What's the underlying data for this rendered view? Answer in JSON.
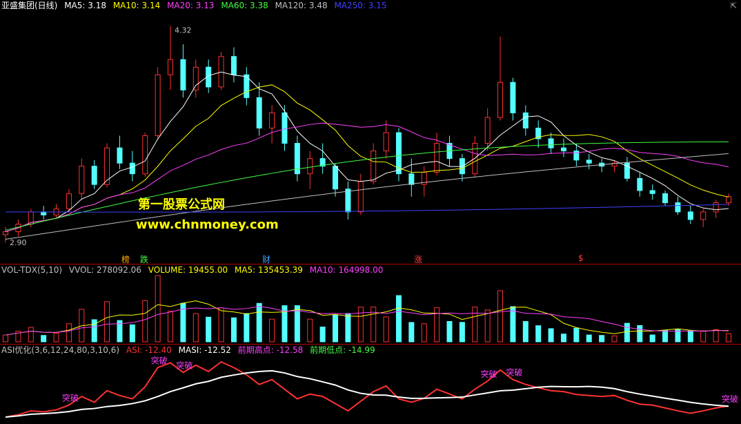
{
  "main": {
    "title": "亚盛集团(日线)",
    "ma": [
      {
        "label": "MA5: 3.18",
        "color": "#ffffff"
      },
      {
        "label": "MA10: 3.14",
        "color": "#ffff00"
      },
      {
        "label": "MA20: 3.13",
        "color": "#ff40ff"
      },
      {
        "label": "MA60: 3.38",
        "color": "#40ff40"
      },
      {
        "label": "MA120: 3.48",
        "color": "#c0c0c0"
      },
      {
        "label": "MA250: 3.15",
        "color": "#4040ff"
      }
    ],
    "high_label": "4.32",
    "low_label": "2.90",
    "events": [
      {
        "label": "榜",
        "color": "#ffb000"
      },
      {
        "label": "跌",
        "color": "#40ff40"
      },
      {
        "label": "财",
        "color": "#40a0ff"
      },
      {
        "label": "涨",
        "color": "#ff4040"
      },
      {
        "label": "$",
        "color": "#ff4040"
      }
    ],
    "watermark_cn": "第一股票公式网",
    "watermark_url": "www.chnmoney.com",
    "colors": {
      "up": "#ff3232",
      "down": "#54ffff",
      "frame": "#b00000"
    }
  },
  "vol": {
    "name": "VOL-TDX(5,10)",
    "items": [
      {
        "label": "VVOL: 278092.06",
        "color": "#c0c0c0"
      },
      {
        "label": "VOLUME: 19455.00",
        "color": "#ffff00"
      },
      {
        "label": "MA5: 135453.39",
        "color": "#ffff00"
      },
      {
        "label": "MA10: 164998.00",
        "color": "#ff40ff"
      }
    ]
  },
  "asi": {
    "name": "ASI优化(3,6,12,24,80,3,10,6)",
    "items": [
      {
        "label": "ASI: -12.40",
        "color": "#ff3232"
      },
      {
        "label": "MASI: -12.52",
        "color": "#ffffff"
      },
      {
        "label": "前期高点: -12.58",
        "color": "#ff40ff"
      },
      {
        "label": "前期低点: -14.99",
        "color": "#40ff40"
      }
    ],
    "breakout_label": "突破"
  },
  "chart_data": {
    "type": "candlestick",
    "high_price": 4.32,
    "low_price": 2.9,
    "ohlc_approx": [
      [
        2.95,
        3.0,
        2.9,
        2.97
      ],
      [
        2.97,
        3.05,
        2.94,
        3.02
      ],
      [
        3.02,
        3.12,
        3.0,
        3.1
      ],
      [
        3.1,
        3.14,
        3.05,
        3.08
      ],
      [
        3.08,
        3.15,
        3.06,
        3.12
      ],
      [
        3.12,
        3.25,
        3.1,
        3.22
      ],
      [
        3.22,
        3.45,
        3.18,
        3.4
      ],
      [
        3.4,
        3.44,
        3.25,
        3.28
      ],
      [
        3.28,
        3.55,
        3.26,
        3.52
      ],
      [
        3.52,
        3.6,
        3.38,
        3.42
      ],
      [
        3.42,
        3.5,
        3.3,
        3.35
      ],
      [
        3.35,
        3.62,
        3.33,
        3.6
      ],
      [
        3.6,
        4.05,
        3.58,
        4.0
      ],
      [
        4.0,
        4.32,
        3.9,
        4.1
      ],
      [
        4.1,
        4.2,
        3.85,
        3.9
      ],
      [
        3.9,
        4.1,
        3.85,
        4.05
      ],
      [
        4.05,
        4.1,
        3.88,
        3.92
      ],
      [
        3.92,
        4.15,
        3.9,
        4.12
      ],
      [
        4.12,
        4.18,
        3.95,
        4.0
      ],
      [
        4.0,
        4.05,
        3.8,
        3.85
      ],
      [
        3.85,
        3.95,
        3.6,
        3.65
      ],
      [
        3.65,
        3.8,
        3.55,
        3.75
      ],
      [
        3.75,
        3.8,
        3.5,
        3.55
      ],
      [
        3.55,
        3.6,
        3.3,
        3.35
      ],
      [
        3.35,
        3.5,
        3.25,
        3.45
      ],
      [
        3.45,
        3.55,
        3.35,
        3.4
      ],
      [
        3.4,
        3.42,
        3.2,
        3.25
      ],
      [
        3.25,
        3.3,
        3.05,
        3.1
      ],
      [
        3.1,
        3.35,
        3.08,
        3.3
      ],
      [
        3.3,
        3.55,
        3.28,
        3.5
      ],
      [
        3.5,
        3.7,
        3.45,
        3.62
      ],
      [
        3.62,
        3.65,
        3.3,
        3.35
      ],
      [
        3.35,
        3.45,
        3.2,
        3.28
      ],
      [
        3.28,
        3.4,
        3.2,
        3.36
      ],
      [
        3.36,
        3.62,
        3.34,
        3.55
      ],
      [
        3.55,
        3.6,
        3.4,
        3.45
      ],
      [
        3.45,
        3.48,
        3.3,
        3.35
      ],
      [
        3.35,
        3.6,
        3.33,
        3.55
      ],
      [
        3.55,
        3.78,
        3.5,
        3.72
      ],
      [
        3.72,
        4.25,
        3.7,
        3.95
      ],
      [
        3.95,
        3.98,
        3.7,
        3.75
      ],
      [
        3.75,
        3.8,
        3.6,
        3.65
      ],
      [
        3.65,
        3.7,
        3.52,
        3.58
      ],
      [
        3.58,
        3.62,
        3.48,
        3.52
      ],
      [
        3.52,
        3.58,
        3.46,
        3.5
      ],
      [
        3.5,
        3.55,
        3.4,
        3.44
      ],
      [
        3.44,
        3.48,
        3.38,
        3.42
      ],
      [
        3.42,
        3.45,
        3.36,
        3.4
      ],
      [
        3.4,
        3.44,
        3.36,
        3.42
      ],
      [
        3.42,
        3.46,
        3.3,
        3.32
      ],
      [
        3.32,
        3.36,
        3.2,
        3.24
      ],
      [
        3.24,
        3.28,
        3.18,
        3.22
      ],
      [
        3.22,
        3.24,
        3.14,
        3.16
      ],
      [
        3.16,
        3.2,
        3.08,
        3.1
      ],
      [
        3.1,
        3.14,
        3.02,
        3.05
      ],
      [
        3.05,
        3.12,
        3.0,
        3.1
      ],
      [
        3.1,
        3.18,
        3.06,
        3.16
      ],
      [
        3.16,
        3.22,
        3.14,
        3.2
      ]
    ]
  }
}
